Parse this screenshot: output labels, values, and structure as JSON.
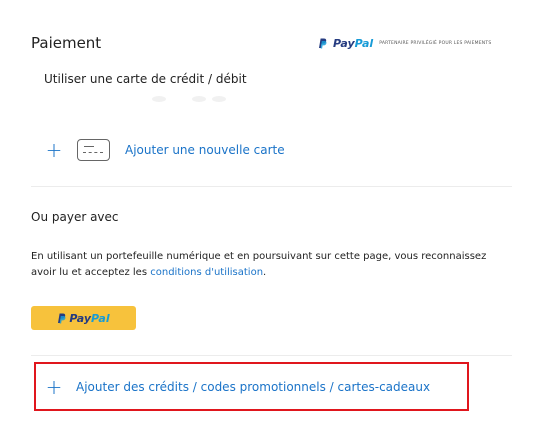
{
  "payment": {
    "title": "Paiement",
    "paypal_badge": {
      "logo_pay": "Pay",
      "logo_pal": "Pal",
      "tagline": "PARTENAIRE PRIVILÉGIÉ POUR LES PAIEMENTS"
    },
    "card_section": {
      "title": "Utiliser une carte de crédit / débit",
      "add_card_label": "Ajouter une nouvelle carte"
    },
    "wallet_section": {
      "title": "Ou payer avec",
      "terms_text": "En utilisant un portefeuille numérique et en poursuivant sur cette page, vous reconnaissez avoir lu et acceptez les ",
      "terms_link": "conditions d'utilisation",
      "terms_end": ".",
      "paypal_button": {
        "pay": "Pay",
        "pal": "Pal"
      }
    },
    "promo": {
      "label": "Ajouter des crédits / codes promotionnels / cartes-cadeaux"
    }
  },
  "colors": {
    "link": "#1a73c8",
    "paypal_button": "#f7c23c",
    "highlight_border": "#e0161d"
  }
}
